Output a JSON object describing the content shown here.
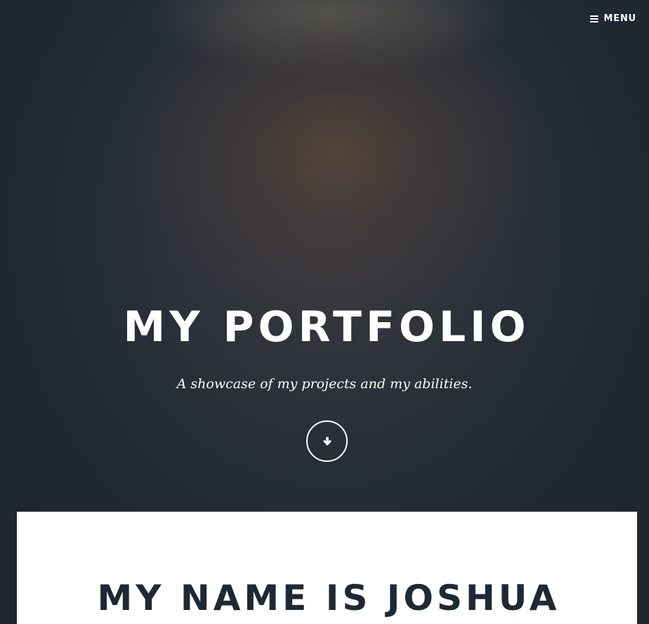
{
  "header": {
    "menu_label": "MENU",
    "menu_icon": "bars-icon"
  },
  "hero": {
    "title": "MY PORTFOLIO",
    "tagline": "A showcase of my projects and my abilities.",
    "scroll_icon": "arrow-down-icon"
  },
  "about": {
    "heading": "MY NAME IS JOSHUA"
  },
  "colors": {
    "hero_background": "#1f262e",
    "hero_glow": "#584638",
    "text_light": "#ffffff",
    "heading_dark": "#1f2933",
    "card_background": "#ffffff"
  }
}
